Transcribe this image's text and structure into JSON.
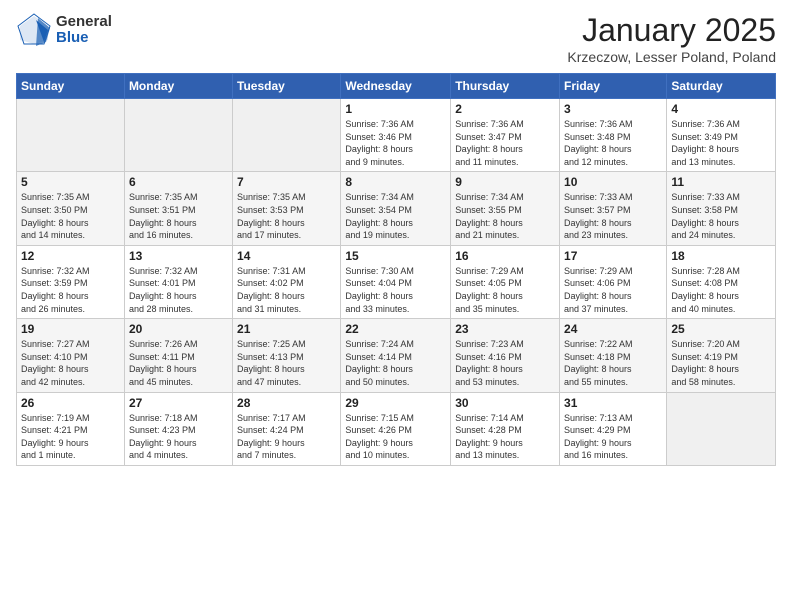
{
  "logo": {
    "general": "General",
    "blue": "Blue"
  },
  "header": {
    "month": "January 2025",
    "location": "Krzeczow, Lesser Poland, Poland"
  },
  "weekdays": [
    "Sunday",
    "Monday",
    "Tuesday",
    "Wednesday",
    "Thursday",
    "Friday",
    "Saturday"
  ],
  "weeks": [
    [
      {
        "day": "",
        "info": ""
      },
      {
        "day": "",
        "info": ""
      },
      {
        "day": "",
        "info": ""
      },
      {
        "day": "1",
        "info": "Sunrise: 7:36 AM\nSunset: 3:46 PM\nDaylight: 8 hours\nand 9 minutes."
      },
      {
        "day": "2",
        "info": "Sunrise: 7:36 AM\nSunset: 3:47 PM\nDaylight: 8 hours\nand 11 minutes."
      },
      {
        "day": "3",
        "info": "Sunrise: 7:36 AM\nSunset: 3:48 PM\nDaylight: 8 hours\nand 12 minutes."
      },
      {
        "day": "4",
        "info": "Sunrise: 7:36 AM\nSunset: 3:49 PM\nDaylight: 8 hours\nand 13 minutes."
      }
    ],
    [
      {
        "day": "5",
        "info": "Sunrise: 7:35 AM\nSunset: 3:50 PM\nDaylight: 8 hours\nand 14 minutes."
      },
      {
        "day": "6",
        "info": "Sunrise: 7:35 AM\nSunset: 3:51 PM\nDaylight: 8 hours\nand 16 minutes."
      },
      {
        "day": "7",
        "info": "Sunrise: 7:35 AM\nSunset: 3:53 PM\nDaylight: 8 hours\nand 17 minutes."
      },
      {
        "day": "8",
        "info": "Sunrise: 7:34 AM\nSunset: 3:54 PM\nDaylight: 8 hours\nand 19 minutes."
      },
      {
        "day": "9",
        "info": "Sunrise: 7:34 AM\nSunset: 3:55 PM\nDaylight: 8 hours\nand 21 minutes."
      },
      {
        "day": "10",
        "info": "Sunrise: 7:33 AM\nSunset: 3:57 PM\nDaylight: 8 hours\nand 23 minutes."
      },
      {
        "day": "11",
        "info": "Sunrise: 7:33 AM\nSunset: 3:58 PM\nDaylight: 8 hours\nand 24 minutes."
      }
    ],
    [
      {
        "day": "12",
        "info": "Sunrise: 7:32 AM\nSunset: 3:59 PM\nDaylight: 8 hours\nand 26 minutes."
      },
      {
        "day": "13",
        "info": "Sunrise: 7:32 AM\nSunset: 4:01 PM\nDaylight: 8 hours\nand 28 minutes."
      },
      {
        "day": "14",
        "info": "Sunrise: 7:31 AM\nSunset: 4:02 PM\nDaylight: 8 hours\nand 31 minutes."
      },
      {
        "day": "15",
        "info": "Sunrise: 7:30 AM\nSunset: 4:04 PM\nDaylight: 8 hours\nand 33 minutes."
      },
      {
        "day": "16",
        "info": "Sunrise: 7:29 AM\nSunset: 4:05 PM\nDaylight: 8 hours\nand 35 minutes."
      },
      {
        "day": "17",
        "info": "Sunrise: 7:29 AM\nSunset: 4:06 PM\nDaylight: 8 hours\nand 37 minutes."
      },
      {
        "day": "18",
        "info": "Sunrise: 7:28 AM\nSunset: 4:08 PM\nDaylight: 8 hours\nand 40 minutes."
      }
    ],
    [
      {
        "day": "19",
        "info": "Sunrise: 7:27 AM\nSunset: 4:10 PM\nDaylight: 8 hours\nand 42 minutes."
      },
      {
        "day": "20",
        "info": "Sunrise: 7:26 AM\nSunset: 4:11 PM\nDaylight: 8 hours\nand 45 minutes."
      },
      {
        "day": "21",
        "info": "Sunrise: 7:25 AM\nSunset: 4:13 PM\nDaylight: 8 hours\nand 47 minutes."
      },
      {
        "day": "22",
        "info": "Sunrise: 7:24 AM\nSunset: 4:14 PM\nDaylight: 8 hours\nand 50 minutes."
      },
      {
        "day": "23",
        "info": "Sunrise: 7:23 AM\nSunset: 4:16 PM\nDaylight: 8 hours\nand 53 minutes."
      },
      {
        "day": "24",
        "info": "Sunrise: 7:22 AM\nSunset: 4:18 PM\nDaylight: 8 hours\nand 55 minutes."
      },
      {
        "day": "25",
        "info": "Sunrise: 7:20 AM\nSunset: 4:19 PM\nDaylight: 8 hours\nand 58 minutes."
      }
    ],
    [
      {
        "day": "26",
        "info": "Sunrise: 7:19 AM\nSunset: 4:21 PM\nDaylight: 9 hours\nand 1 minute."
      },
      {
        "day": "27",
        "info": "Sunrise: 7:18 AM\nSunset: 4:23 PM\nDaylight: 9 hours\nand 4 minutes."
      },
      {
        "day": "28",
        "info": "Sunrise: 7:17 AM\nSunset: 4:24 PM\nDaylight: 9 hours\nand 7 minutes."
      },
      {
        "day": "29",
        "info": "Sunrise: 7:15 AM\nSunset: 4:26 PM\nDaylight: 9 hours\nand 10 minutes."
      },
      {
        "day": "30",
        "info": "Sunrise: 7:14 AM\nSunset: 4:28 PM\nDaylight: 9 hours\nand 13 minutes."
      },
      {
        "day": "31",
        "info": "Sunrise: 7:13 AM\nSunset: 4:29 PM\nDaylight: 9 hours\nand 16 minutes."
      },
      {
        "day": "",
        "info": ""
      }
    ]
  ]
}
